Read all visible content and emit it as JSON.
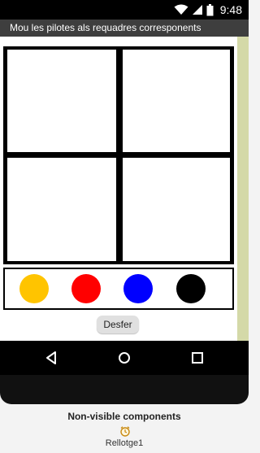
{
  "status_bar": {
    "time": "9:48",
    "icons": [
      "wifi-icon",
      "cell-signal-icon",
      "battery-icon"
    ]
  },
  "app": {
    "title": "Mou les pilotes als requadres corresponents",
    "undo_label": "Desfer",
    "balls": [
      {
        "name": "yellow",
        "color": "#ffc400"
      },
      {
        "name": "red",
        "color": "#ff0000"
      },
      {
        "name": "blue",
        "color": "#0000ff"
      },
      {
        "name": "black",
        "color": "#000000"
      }
    ]
  },
  "navigation": {
    "icons": [
      "back-icon",
      "home-icon",
      "recents-icon"
    ]
  },
  "non_visible": {
    "title": "Non-visible components",
    "items": [
      {
        "icon": "clock-icon",
        "label": "Rellotge1"
      }
    ]
  }
}
